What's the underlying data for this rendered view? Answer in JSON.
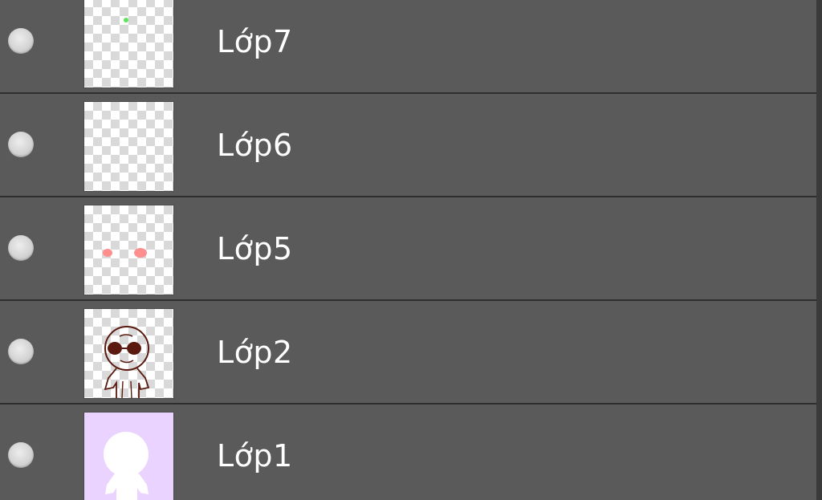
{
  "layers_panel": {
    "layers": [
      {
        "name": "Lớp7",
        "visible": true,
        "thumbnail": "green-dot"
      },
      {
        "name": "Lớp6",
        "visible": true,
        "thumbnail": "empty"
      },
      {
        "name": "Lớp5",
        "visible": true,
        "thumbnail": "pink-cheeks"
      },
      {
        "name": "Lớp2",
        "visible": true,
        "thumbnail": "chibi-lineart"
      },
      {
        "name": "Lớp1",
        "visible": true,
        "thumbnail": "lavender-silhouette"
      }
    ]
  },
  "colors": {
    "row_background": "#5a5a5a",
    "row_separator": "#2e2e2e",
    "label_text": "#ffffff",
    "layer1_fill": "#ead3ff",
    "blush": "#ff8f8f",
    "lineart": "#5a1a0f",
    "green_dot": "#5ee35e"
  }
}
